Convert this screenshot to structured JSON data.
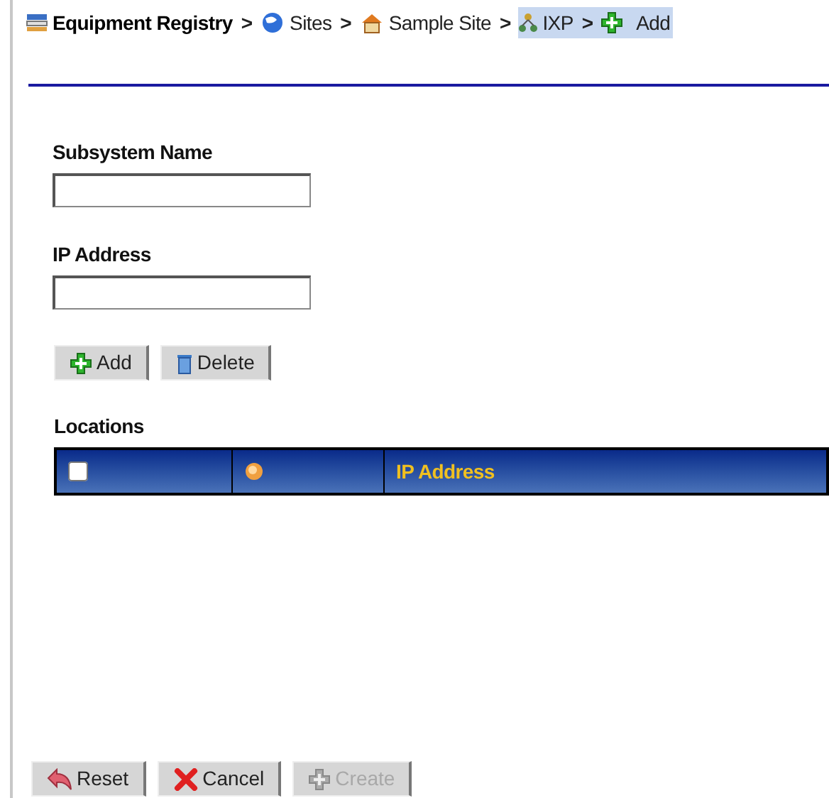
{
  "breadcrumb": [
    {
      "label": "Equipment Registry",
      "kind": "registry",
      "bold": true,
      "selected": false,
      "separator": ">"
    },
    {
      "label": "Sites",
      "kind": "globe",
      "bold": false,
      "selected": false,
      "separator": ">"
    },
    {
      "label": "Sample Site",
      "kind": "house",
      "bold": false,
      "selected": false,
      "separator": ">"
    },
    {
      "label": "IXP",
      "kind": "network",
      "bold": false,
      "selected": true,
      "separator": ">"
    },
    {
      "label": "Add",
      "kind": "plus",
      "bold": false,
      "selected": true
    }
  ],
  "fields": [
    {
      "label": "Subsystem Name"
    },
    {
      "label": "IP Address"
    }
  ],
  "list_buttons": [
    {
      "label": "Add",
      "kind": "plus",
      "disabled": false
    },
    {
      "label": "Delete",
      "kind": "trash",
      "disabled": false
    }
  ],
  "locations": {
    "title": "Locations",
    "select_all": {
      "checked": false
    },
    "columns": [
      {
        "kind": "checkbox"
      },
      {
        "kind": "icon"
      },
      {
        "kind": "text",
        "label": "IP Address"
      }
    ]
  },
  "footer_buttons": [
    {
      "label": "Reset",
      "kind": "undo",
      "disabled": false
    },
    {
      "label": "Cancel",
      "kind": "cross",
      "disabled": false
    },
    {
      "label": "Create",
      "kind": "plus",
      "disabled": true
    }
  ]
}
